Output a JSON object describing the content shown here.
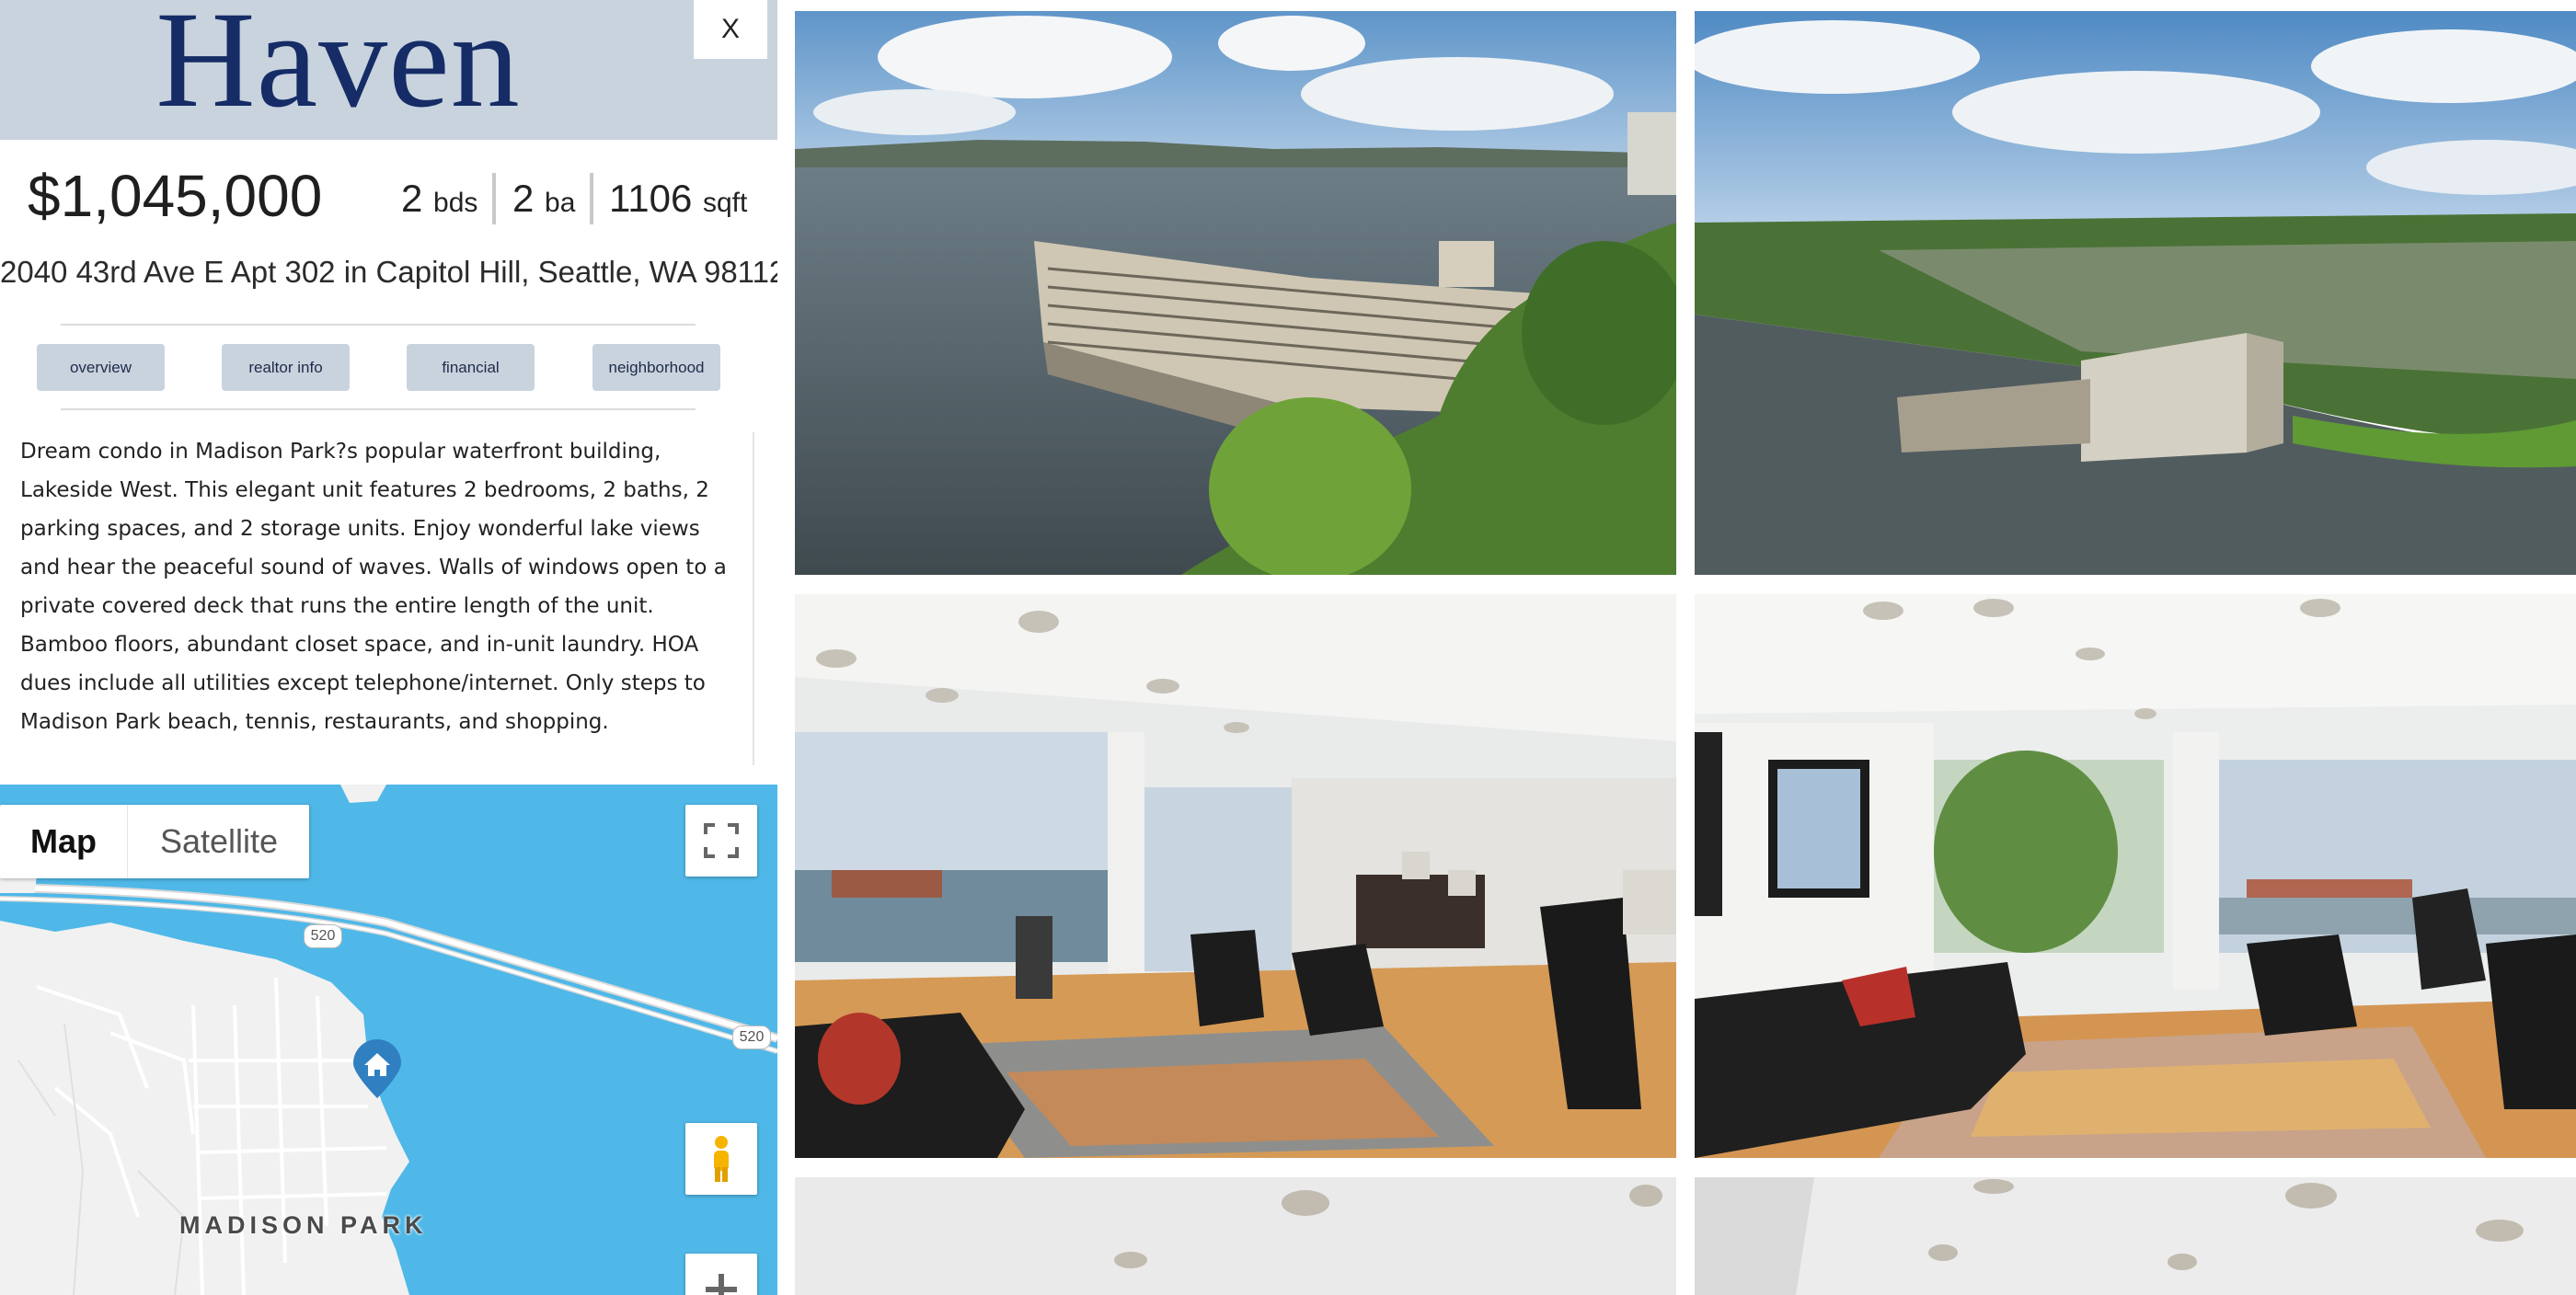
{
  "brand": "Haven",
  "close_label": "X",
  "listing": {
    "price": "$1,045,000",
    "beds": "2",
    "beds_unit": "bds",
    "baths": "2",
    "baths_unit": "ba",
    "sqft": "1106",
    "sqft_unit": "sqft",
    "address": "2040 43rd Ave E Apt 302 in Capitol Hill, Seattle, WA 98112"
  },
  "tabs": [
    {
      "label": "overview"
    },
    {
      "label": "realtor info"
    },
    {
      "label": "financial"
    },
    {
      "label": "neighborhood"
    }
  ],
  "description": "Dream condo in Madison Park?s popular waterfront building, Lakeside West. This elegant unit features 2 bedrooms, 2 baths, 2 parking spaces, and 2 storage units. Enjoy wonderful lake views and hear the peaceful sound of waves. Walls of windows open to a private covered deck that runs the entire length of the unit. Bamboo floors, abundant closet space, and in-unit laundry. HOA dues include all utilities except telephone/internet. Only steps to Madison Park beach, tennis, restaurants, and shopping.",
  "map": {
    "map_label": "Map",
    "satellite_label": "Satellite",
    "place_label": "MADISON PARK",
    "highway_label_1": "520",
    "highway_label_2": "520",
    "zoom_in_label": "+",
    "water_color": "#4fb8e8",
    "land_color": "#f1f1f1",
    "marker_color": "#2f7fc1"
  },
  "photos": [
    {
      "icon": "aerial-building-photo"
    },
    {
      "icon": "aerial-neighborhood-photo"
    },
    {
      "icon": "living-room-photo"
    },
    {
      "icon": "living-room-sofa-photo"
    },
    {
      "icon": "ceiling-photo"
    },
    {
      "icon": "ceiling-photo"
    }
  ],
  "colors": {
    "brand_bar": "#c9d3de",
    "brand_text": "#152c66",
    "tab_bg": "#c9d3de"
  }
}
